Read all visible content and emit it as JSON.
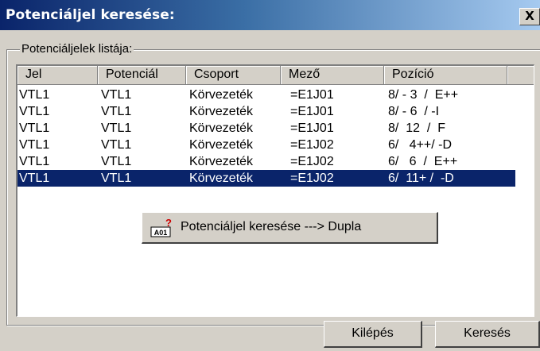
{
  "window": {
    "title": "Potenciáljel keresése:",
    "close_label": "X"
  },
  "group": {
    "label": "Potenciáljelek listája:"
  },
  "columns": [
    "Jel",
    "Potenciál",
    "Csoport",
    "Mező",
    "Pozíció"
  ],
  "rows": [
    [
      "VTL1",
      "VTL1",
      "Körvezeték",
      "=E1J01",
      "8/ - 3  /  E++"
    ],
    [
      "VTL1",
      "VTL1",
      "Körvezeték",
      "=E1J01",
      "8/ - 6  / -I"
    ],
    [
      "VTL1",
      "VTL1",
      "Körvezeték",
      "=E1J01",
      "8/  12  /  F"
    ],
    [
      "VTL1",
      "VTL1",
      "Körvezeték",
      "=E1J02",
      "6/   4++/ -D"
    ],
    [
      "VTL1",
      "VTL1",
      "Körvezeték",
      "=E1J02",
      "6/   6  /  E++"
    ],
    [
      "VTL1",
      "VTL1",
      "Körvezeték",
      "=E1J02",
      "6/  11+ /  -D"
    ]
  ],
  "selected_row": 5,
  "context_menu": {
    "item_label": "Potenciáljel keresése  ---> Dupla",
    "icon": "search-potential-icon",
    "icon_text": "A01"
  },
  "buttons": {
    "exit_label": "Kilépés",
    "search_label": "Keresés"
  },
  "colors": {
    "selection": "#0a246a",
    "title_start": "#0a246a",
    "title_end": "#a6caf0",
    "face": "#d4d0c8"
  }
}
